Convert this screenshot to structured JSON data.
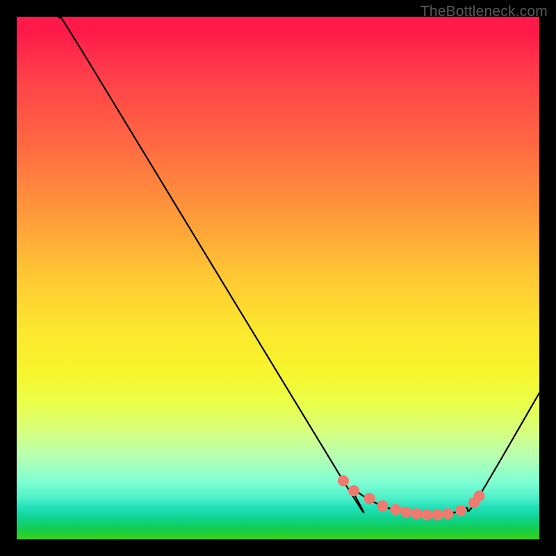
{
  "watermark": "TheBottleneck.com",
  "chart_data": {
    "type": "line",
    "title": "",
    "xlabel": "",
    "ylabel": "",
    "xlim": [
      0,
      100
    ],
    "ylim": [
      0,
      100
    ],
    "grid": false,
    "series": [
      {
        "name": "curve",
        "x": [
          8,
          14,
          62,
          64,
          66,
          68,
          70,
          72,
          74,
          76,
          78,
          80,
          82,
          84,
          86,
          88,
          100
        ],
        "values": [
          100,
          91,
          12,
          10,
          8.5,
          7.3,
          6.4,
          5.7,
          5.2,
          4.9,
          4.7,
          4.7,
          4.9,
          5.2,
          6,
          7.5,
          28
        ]
      }
    ],
    "marker_series": {
      "name": "markers",
      "color": "#f07a6e",
      "x": [
        62.5,
        64.5,
        67.5,
        70,
        72.5,
        74.5,
        76.5,
        78.5,
        80.5,
        82.5,
        85,
        87.5,
        88.5
      ],
      "values": [
        11.2,
        9.3,
        7.8,
        6.4,
        5.7,
        5.2,
        4.9,
        4.7,
        4.7,
        4.9,
        5.5,
        7,
        8.3
      ]
    },
    "background_gradient": {
      "top_color": "#ff1a4a",
      "bottom_color": "#3ed41c",
      "type": "vertical"
    }
  }
}
